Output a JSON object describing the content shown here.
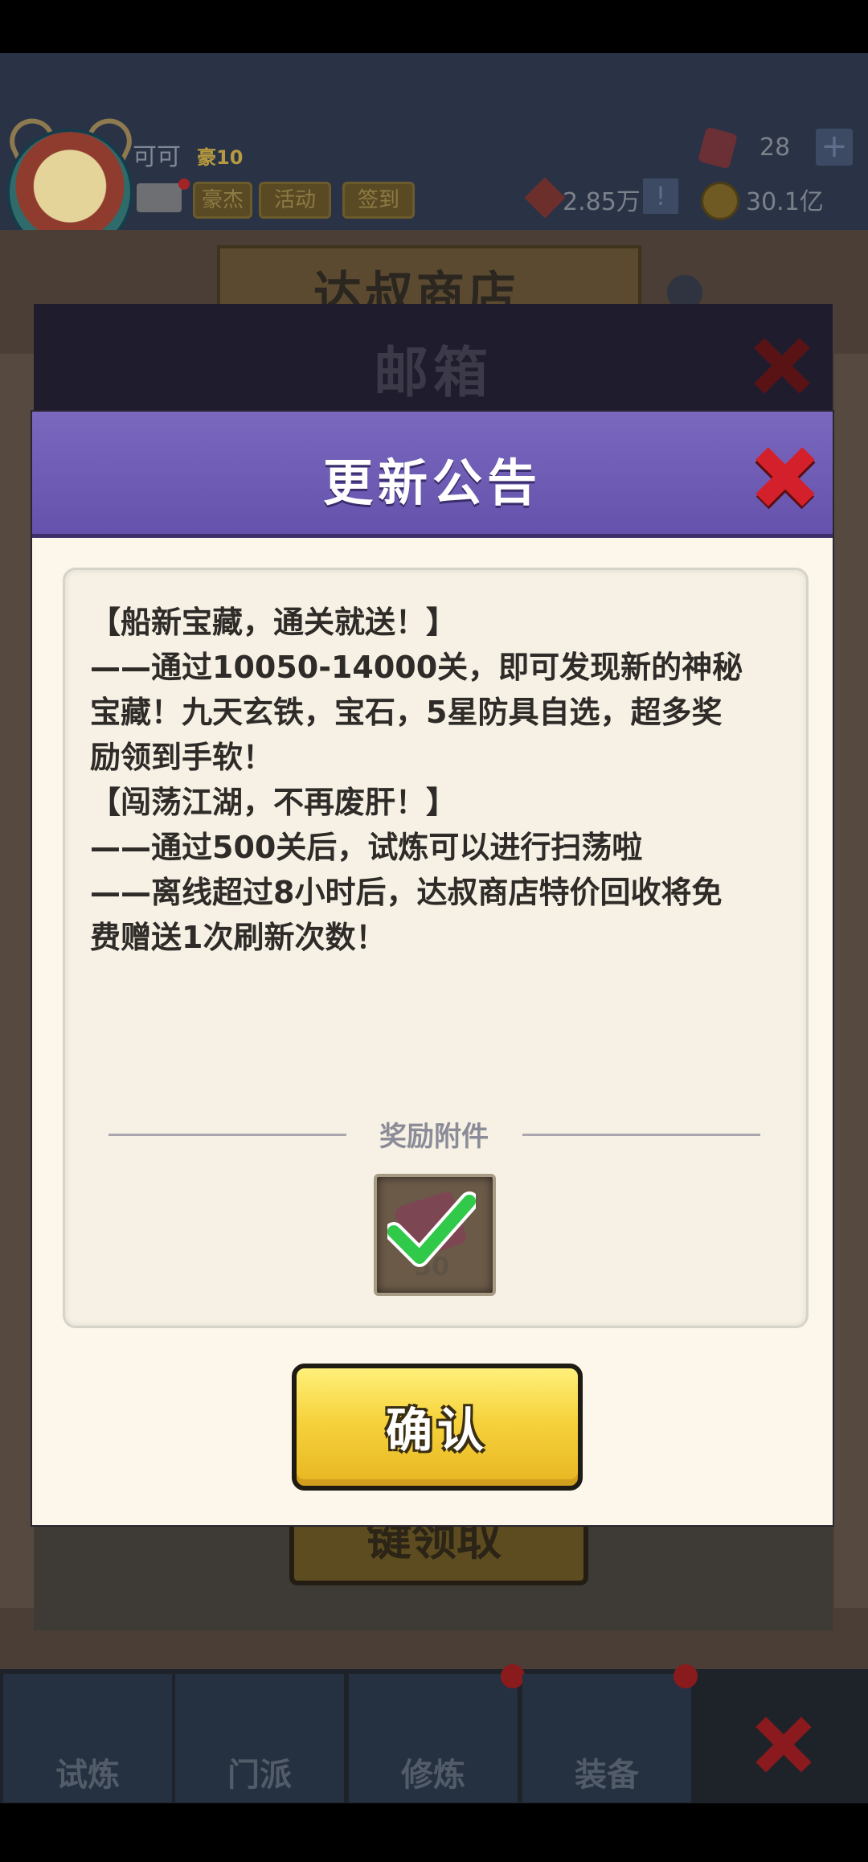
{
  "background": {
    "player": {
      "name": "可可",
      "vip": "豪10"
    },
    "hud_buttons": [
      "豪杰",
      "活动",
      "签到"
    ],
    "gems": "28",
    "plus": "+",
    "power": "2.85万",
    "alert": "!",
    "coins": "30.1亿",
    "shop_title": "达叔商店",
    "scene_button": "键领取"
  },
  "mailbox": {
    "title": "邮箱"
  },
  "bottom_nav": {
    "items": [
      "试炼",
      "门派",
      "修炼",
      "装备"
    ]
  },
  "modal": {
    "title": "更新公告",
    "lines": [
      "【船新宝藏，通关就送！】",
      "——通过10050-14000关，即可发现新的神秘",
      "宝藏！九天玄铁，宝石，5星防具自选，超多奖",
      "励领到手软！",
      "【闯荡江湖，不再废肝！】",
      "——通过500关后，试炼可以进行扫荡啦",
      "——离线超过8小时后，达叔商店特价回收将免",
      "费赠送1次刷新次数！"
    ],
    "reward_label": "奖励附件",
    "reward_item": {
      "icon": "gem-icon",
      "quantity": "50",
      "claimed": true
    },
    "confirm_label": "确认"
  },
  "colors": {
    "header_purple": "#6a57b3",
    "confirm_yellow": "#f6d23c",
    "check_green": "#31c94a",
    "close_red": "#d3202a"
  }
}
